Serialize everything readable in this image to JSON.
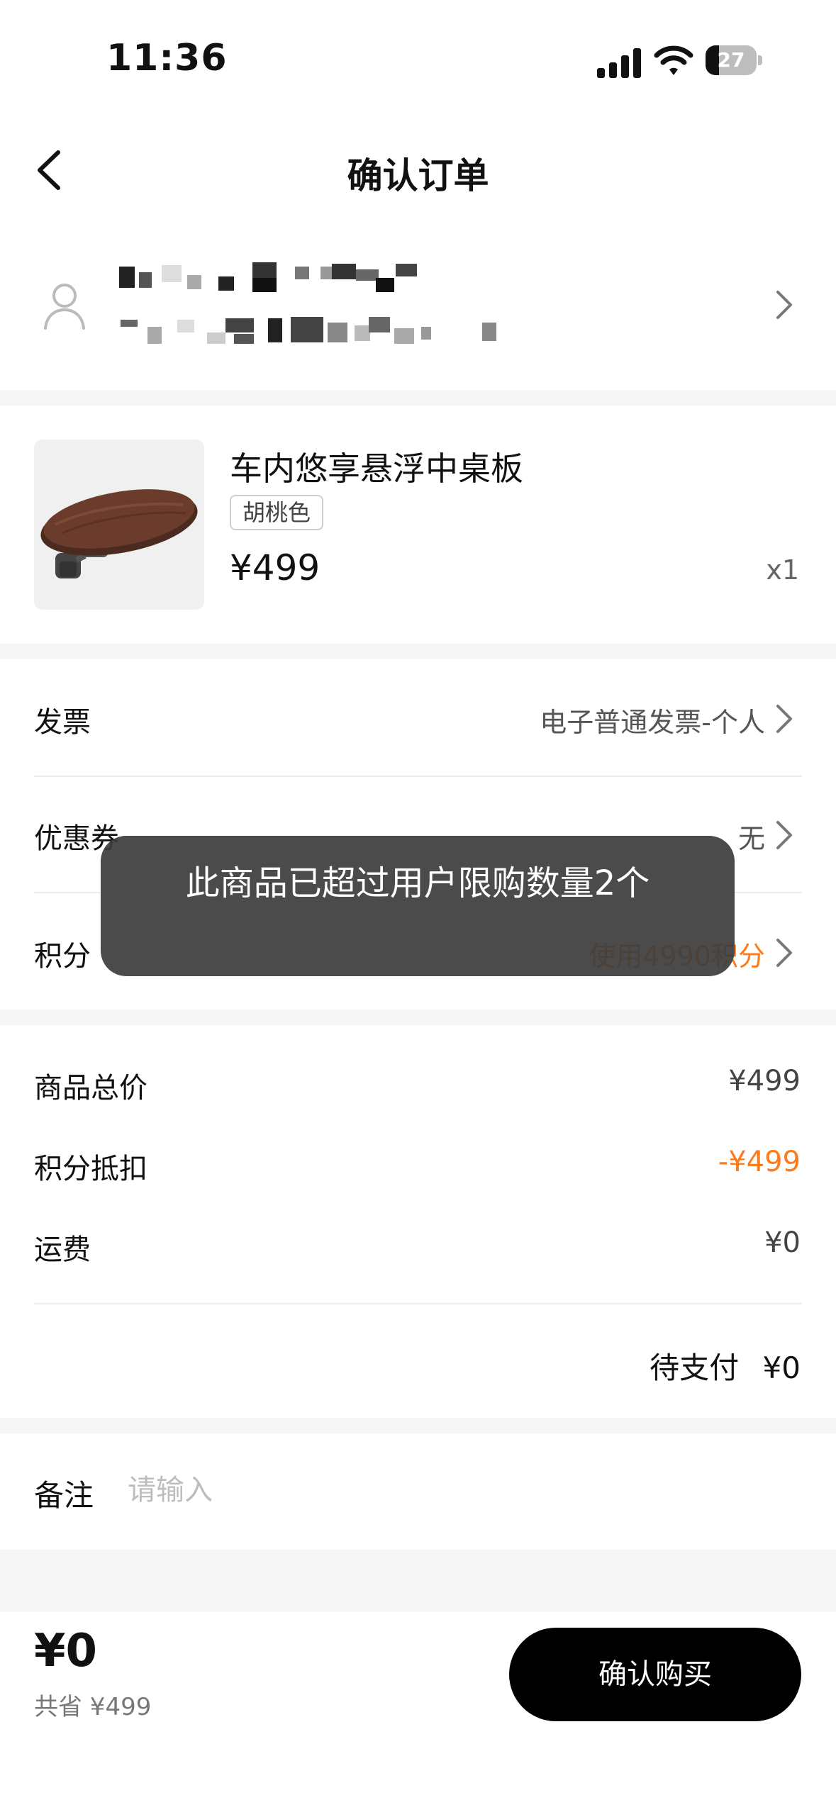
{
  "status_bar": {
    "time": "11:36",
    "battery": "27",
    "battery_level": 0.27
  },
  "nav": {
    "title": "确认订单",
    "back_icon": "chevron-left-icon"
  },
  "address": {
    "icon": "person-icon",
    "chevron_icon": "chevron-right-icon"
  },
  "product": {
    "name": "车内悠享悬浮中桌板",
    "spec": "胡桃色",
    "price": "¥499",
    "quantity": "x1"
  },
  "options": {
    "invoice": {
      "label": "发票",
      "value": "电子普通发票-个人"
    },
    "coupon": {
      "label": "优惠券",
      "value": "无"
    },
    "points": {
      "label": "积分",
      "value": "使用4990积分"
    }
  },
  "summary": {
    "subtotal_label": "商品总价",
    "subtotal": "¥499",
    "points_label": "积分抵扣",
    "points_deduction": "-¥499",
    "shipping_label": "运费",
    "shipping": "¥0",
    "pending_label": "待支付",
    "pending": "¥0"
  },
  "note": {
    "label": "备注",
    "placeholder": "请输入"
  },
  "footer": {
    "total": "¥0",
    "saved": "共省 ¥499",
    "confirm_label": "确认购买"
  },
  "toast": {
    "message": "此商品已超过用户限购数量2个"
  },
  "colors": {
    "accent": "#ff7a1a",
    "button": "#000000"
  }
}
